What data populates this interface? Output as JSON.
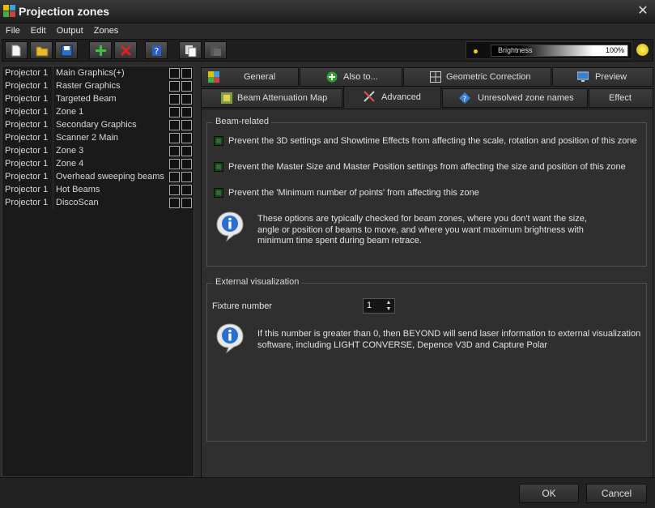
{
  "window": {
    "title": "Projection zones"
  },
  "menu": [
    "File",
    "Edit",
    "Output",
    "Zones"
  ],
  "toolbar": {
    "brightness_label": "Brightness",
    "brightness_value": "100%",
    "brightness_level": 1.0
  },
  "zones": [
    {
      "projector": "Projector 1",
      "name": "Main Graphics(+)"
    },
    {
      "projector": "Projector 1",
      "name": "Raster Graphics"
    },
    {
      "projector": "Projector 1",
      "name": "Targeted Beam"
    },
    {
      "projector": "Projector 1",
      "name": "Zone 1"
    },
    {
      "projector": "Projector 1",
      "name": "Secondary Graphics"
    },
    {
      "projector": "Projector 1",
      "name": "Scanner 2 Main"
    },
    {
      "projector": "Projector 1",
      "name": "Zone 3"
    },
    {
      "projector": "Projector 1",
      "name": "Zone 4"
    },
    {
      "projector": "Projector 1",
      "name": "Overhead sweeping beams"
    },
    {
      "projector": "Projector 1",
      "name": "Hot Beams"
    },
    {
      "projector": "Projector 1",
      "name": "DiscoScan"
    }
  ],
  "tabs": {
    "general": "General",
    "also_to": "Also to...",
    "geometric": "Geometric Correction",
    "preview": "Preview",
    "beam_attenuation": "Beam Attenuation Map",
    "advanced": "Advanced",
    "unresolved": "Unresolved zone names",
    "effect": "Effect"
  },
  "beam": {
    "title": "Beam-related",
    "opt1": "Prevent the 3D settings and Showtime Effects from affecting the scale, rotation and position of this zone",
    "opt2": "Prevent the Master Size and Master Position settings from affecting the size and position of this zone",
    "opt3": "Prevent the 'Minimum number of points' from affecting this zone",
    "info_line1": "These options are typically checked for beam zones, where you don't want the size,",
    "info_line2": "angle or position of beams to move, and where you want maximum brightness with",
    "info_line3": "minimum time spent during beam retrace."
  },
  "external": {
    "title": "External visualization",
    "fixture_label": "Fixture number",
    "fixture_value": "1",
    "info_line1": "If this number is greater than 0, then BEYOND will send laser information to external visualization",
    "info_line2": "software, including LIGHT CONVERSE, Depence V3D and Capture Polar"
  },
  "footer": {
    "ok": "OK",
    "cancel": "Cancel"
  },
  "colors": {
    "checked_green": "#2f6a2f",
    "sun_yellow": "#f5d000"
  }
}
